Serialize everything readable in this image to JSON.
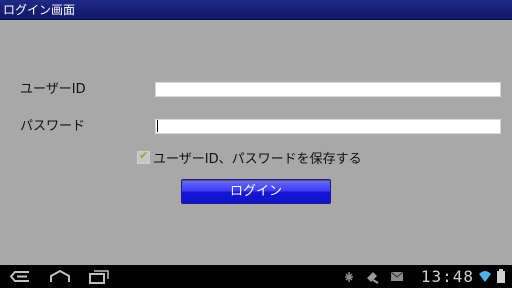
{
  "window": {
    "title": "ログイン画面"
  },
  "form": {
    "user_id_label": "ユーザーID",
    "user_id_value": "",
    "password_label": "パスワード",
    "password_value": "",
    "remember_label": "ユーザーID、パスワードを保存する",
    "remember_checked": true,
    "login_button_label": "ログイン"
  },
  "system_bar": {
    "time": "13:48",
    "icons": [
      "back-icon",
      "home-icon",
      "recent-apps-icon",
      "debug-icon",
      "usb-icon",
      "email-icon",
      "wifi-icon",
      "battery-icon"
    ]
  }
}
